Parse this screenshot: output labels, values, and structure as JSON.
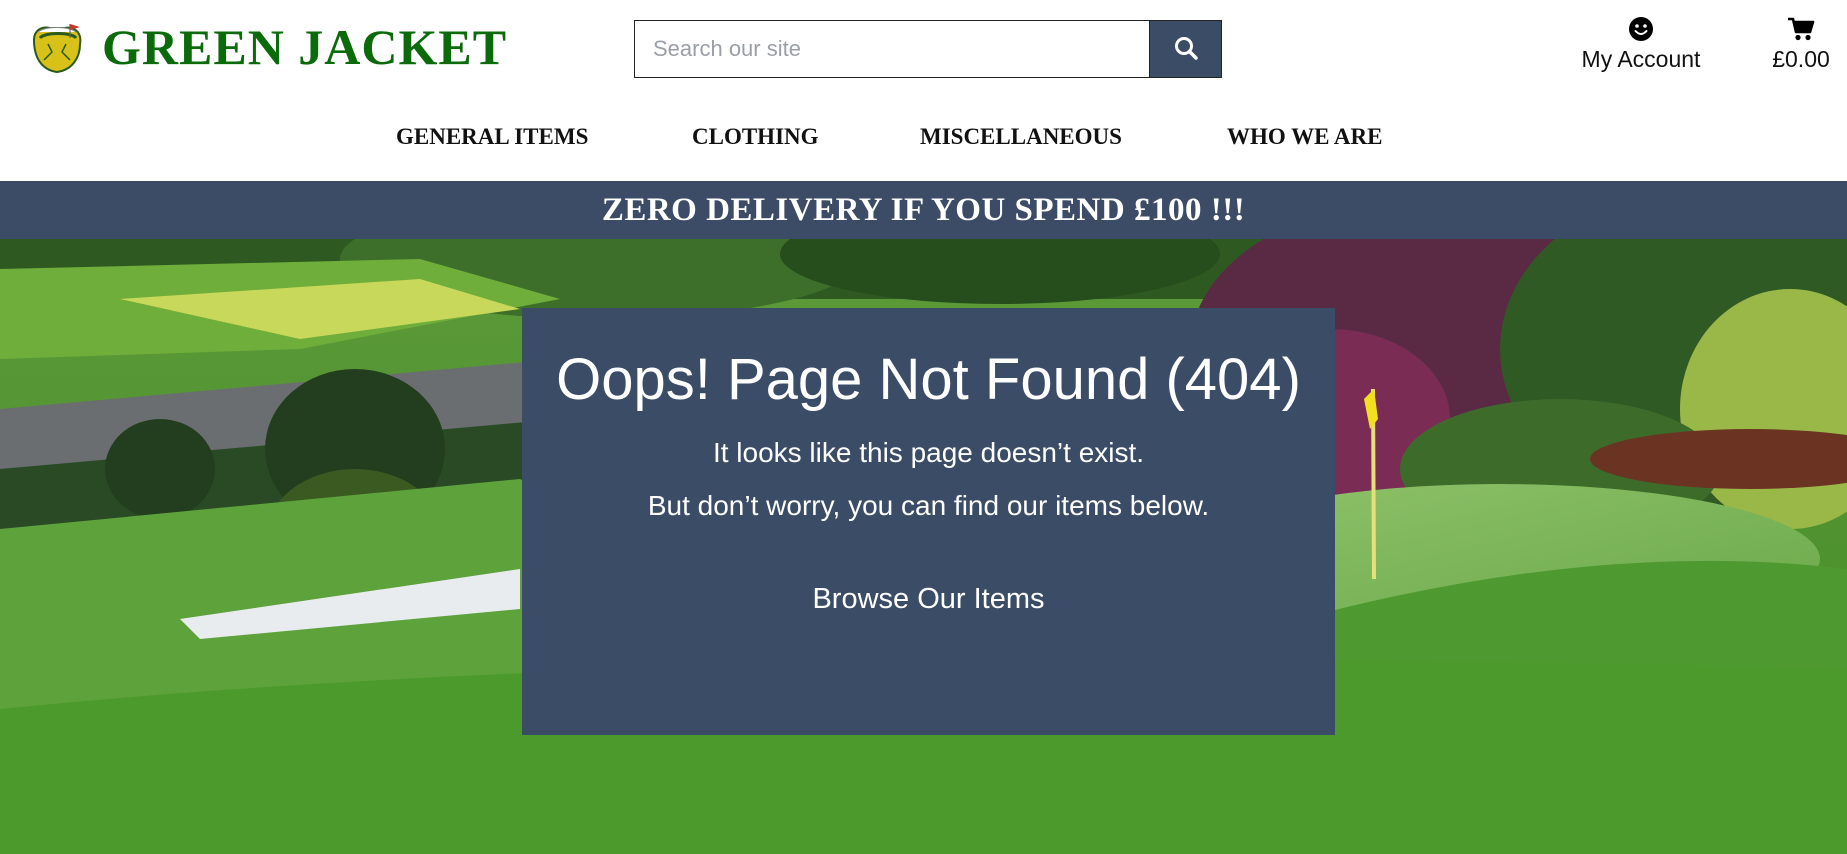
{
  "header": {
    "brand_name": "GREEN JACKET",
    "logo_icon": "masters-logo-icon",
    "search": {
      "placeholder": "Search our site",
      "value": "",
      "button_icon": "search-icon"
    },
    "account": {
      "icon": "smiley-icon",
      "label": "My Account"
    },
    "cart": {
      "icon": "cart-icon",
      "total": "£0.00"
    }
  },
  "nav": {
    "items": [
      {
        "label": "GENERAL ITEMS"
      },
      {
        "label": "CLOTHING"
      },
      {
        "label": "MISCELLANEOUS"
      },
      {
        "label": "WHO WE ARE"
      }
    ]
  },
  "banner": {
    "text": "ZERO DELIVERY IF YOU SPEND £100 !!!"
  },
  "error": {
    "title": "Oops! Page Not Found (404)",
    "line1": "It looks like this page doesn’t exist.",
    "line2": "But don’t worry, you can find our items below.",
    "button_label": "Browse Our Items"
  },
  "colors": {
    "brand_green": "#0b6b0b",
    "navy": "#3b4c66",
    "white": "#ffffff"
  }
}
